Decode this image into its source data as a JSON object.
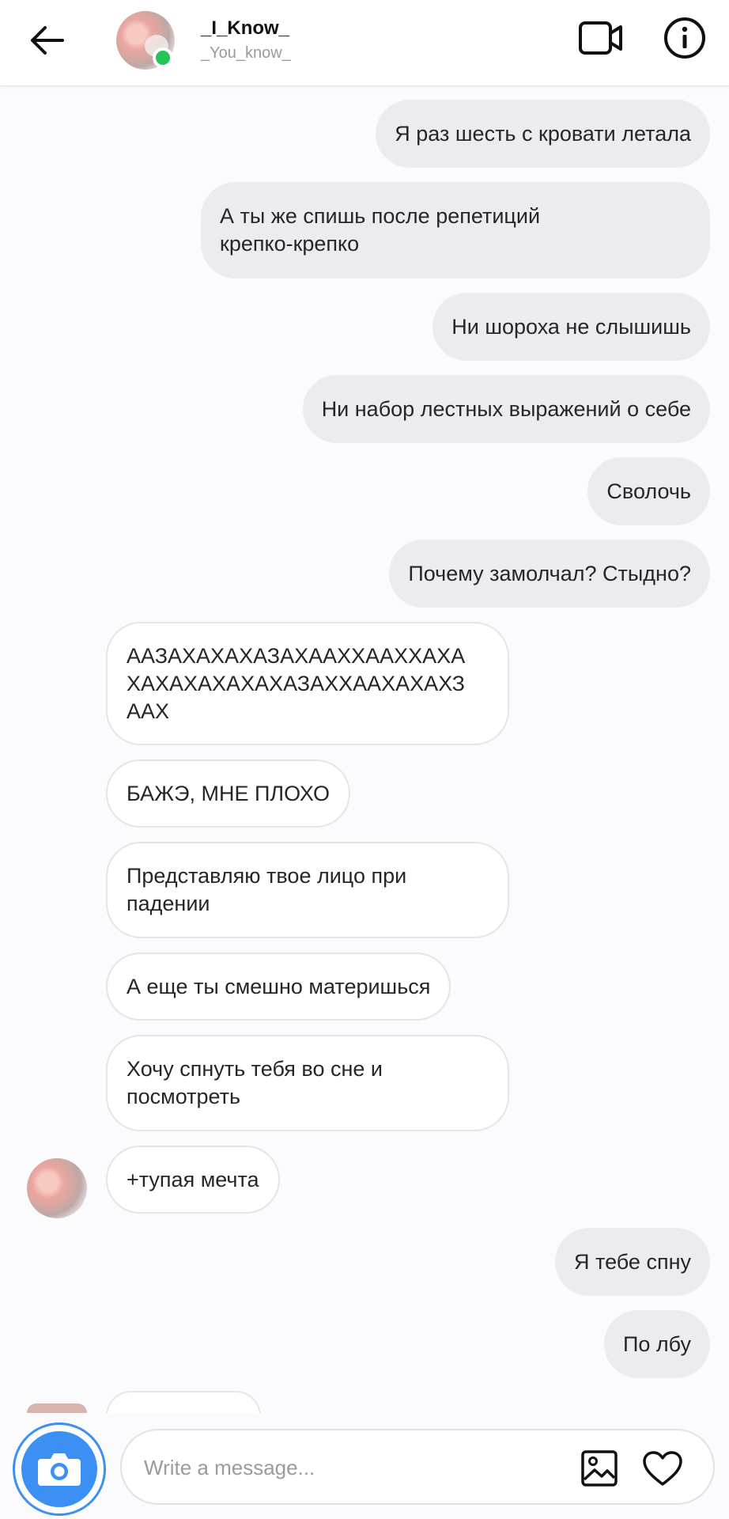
{
  "header": {
    "name": "_I_Know_",
    "username": "_You_know_"
  },
  "messages": [
    {
      "side": "out",
      "text": "Я раз шесть с кровати летала"
    },
    {
      "side": "out",
      "lines": [
        "А ты же спишь после репетиций",
        "крепко-крепко"
      ]
    },
    {
      "side": "out",
      "text": "Ни шороха не слышишь"
    },
    {
      "side": "out",
      "text": "Ни набор лестных выражений о себе"
    },
    {
      "side": "out",
      "text": "Сволочь"
    },
    {
      "side": "out",
      "text": "Почему замолчал? Стыдно?"
    },
    {
      "side": "in",
      "lines": [
        "ААЗАХАХАХАЗАХААХХААХХАХА",
        "ХАХАХАХАХАХАЗАХХААХАХАХЗ",
        "ААХ"
      ]
    },
    {
      "side": "in",
      "text": "БАЖЭ, МНЕ ПЛОХО"
    },
    {
      "side": "in",
      "lines": [
        "Представляю твое лицо при",
        "падении"
      ]
    },
    {
      "side": "in",
      "text": "А еще ты смешно материшься"
    },
    {
      "side": "in",
      "lines": [
        "Хочу спнуть тебя во сне и",
        "посмотреть"
      ]
    },
    {
      "side": "in",
      "text": "+тупая мечта"
    },
    {
      "side": "out",
      "text": "Я тебе спну"
    },
    {
      "side": "out",
      "text": "По лбу"
    }
  ],
  "composer": {
    "placeholder": "Write a message..."
  },
  "icons": {
    "back": "arrow-left-icon",
    "video": "video-camera-icon",
    "info": "info-icon",
    "camera": "camera-icon",
    "gallery": "image-icon",
    "like": "heart-icon"
  },
  "colors": {
    "online": "#25c35a",
    "camera_button": "#3c90f3",
    "outgoing_bubble": "#ecebf0",
    "incoming_bubble": "#ffffff"
  }
}
